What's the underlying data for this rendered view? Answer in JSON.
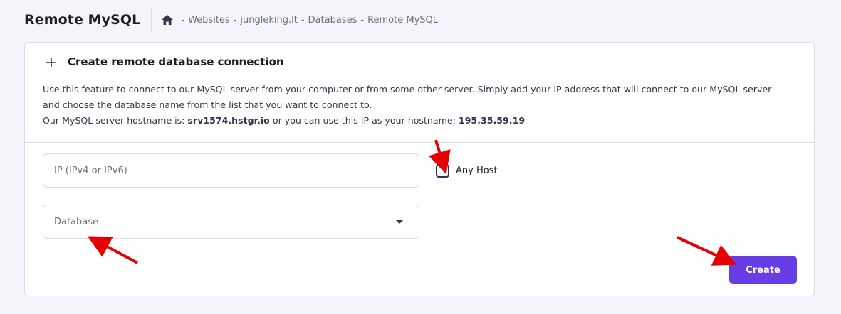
{
  "header": {
    "title": "Remote MySQL",
    "breadcrumb": {
      "home_icon": "home-icon",
      "separator": "-",
      "items": [
        "Websites",
        "jungleking.lt",
        "Databases",
        "Remote MySQL"
      ]
    }
  },
  "card": {
    "title": "Create remote database connection",
    "description_line1": "Use this feature to connect to our MySQL server from your computer or from some other server. Simply add your IP address that will connect to our MySQL server",
    "description_line2": "and choose the database name from the list that you want to connect to.",
    "hostname_prefix": "Our MySQL server hostname is:",
    "hostname": "srv1574.hstgr.io",
    "hostname_middle": "or you can use this IP as your hostname:",
    "hostname_ip": "195.35.59.19"
  },
  "form": {
    "ip_placeholder": "IP (IPv4 or IPv6)",
    "any_host_label": "Any Host",
    "any_host_checked": false,
    "database_placeholder": "Database",
    "create_label": "Create"
  },
  "colors": {
    "accent": "#673de6",
    "annotation_arrow": "#e60000",
    "page_background": "#f4f5fa"
  }
}
